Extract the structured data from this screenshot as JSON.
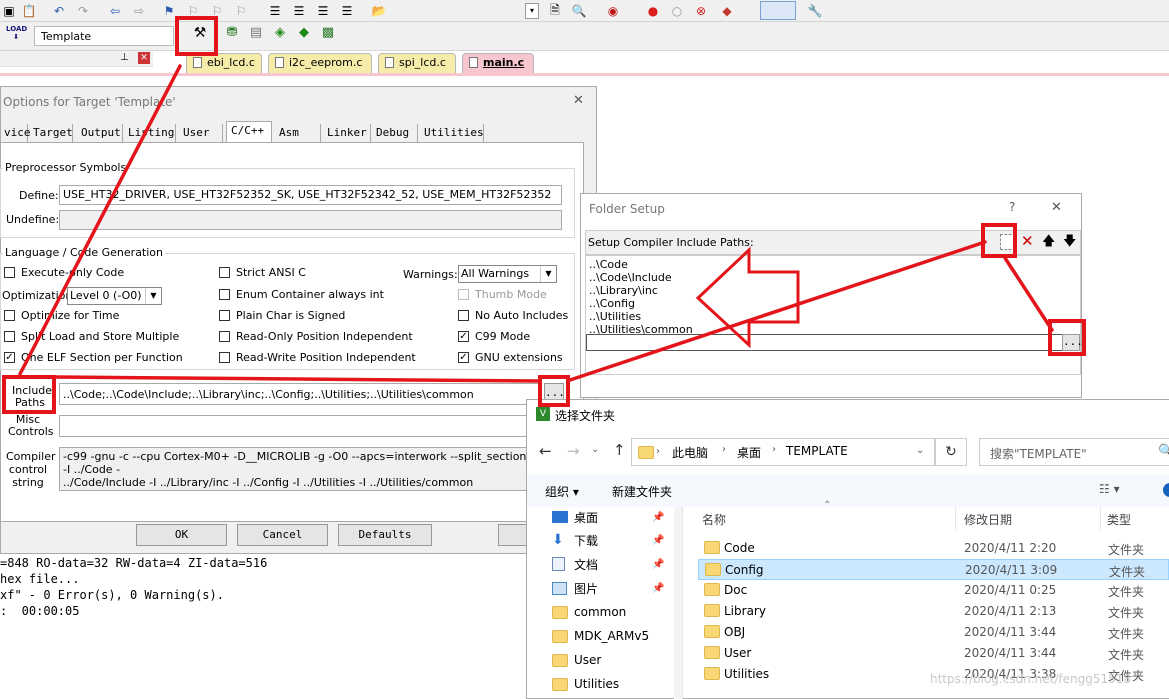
{
  "toolbar": {
    "target_name": "Template"
  },
  "file_tabs": [
    "ebi_lcd.c",
    "i2c_eeprom.c",
    "spi_lcd.c",
    "main.c"
  ],
  "options_dialog": {
    "title": "Options for Target 'Template'",
    "close": "✕",
    "tabs": [
      "vice",
      "Target",
      "Output",
      "Listing",
      "User",
      "C/C++",
      "Asm",
      "Linker",
      "Debug",
      "Utilities"
    ],
    "active_tab": "C/C++",
    "preprocessor": {
      "group": "Preprocessor Symbols",
      "define_label": "Define:",
      "define_value": "USE_HT32_DRIVER, USE_HT32F52352_SK, USE_HT32F52342_52, USE_MEM_HT32F52352",
      "undefine_label": "Undefine:",
      "undefine_value": ""
    },
    "language": {
      "group": "Language / Code Generation",
      "col1": [
        {
          "label": "Execute-only Code",
          "checked": false
        },
        {
          "label": "Optimize for Time",
          "checked": false
        },
        {
          "label": "Split Load and Store Multiple",
          "checked": false
        },
        {
          "label": "One ELF Section per Function",
          "checked": true
        }
      ],
      "optimization_label": "Optimization:",
      "optimization_value": "Level 0 (-O0)",
      "col2": [
        {
          "label": "Strict ANSI C",
          "checked": false
        },
        {
          "label": "Enum Container always int",
          "checked": false
        },
        {
          "label": "Plain Char is Signed",
          "checked": false
        },
        {
          "label": "Read-Only Position Independent",
          "checked": false
        },
        {
          "label": "Read-Write Position Independent",
          "checked": false
        }
      ],
      "warnings_label": "Warnings:",
      "warnings_value": "All Warnings",
      "col3": [
        {
          "label": "Thumb Mode",
          "checked": false,
          "disabled": true
        },
        {
          "label": "No Auto Includes",
          "checked": false
        },
        {
          "label": "C99 Mode",
          "checked": true
        },
        {
          "label": "GNU extensions",
          "checked": true
        }
      ]
    },
    "include_label_1": "Include",
    "include_label_2": "Paths",
    "include_value": "..\\Code;..\\Code\\Include;..\\Library\\inc;..\\Config;..\\Utilities;..\\Utilities\\common",
    "misc_label_1": "Misc",
    "misc_label_2": "Controls",
    "compiler_label_1": "Compiler",
    "compiler_label_2": "control",
    "compiler_label_3": "string",
    "compiler_line1": "-c99 -gnu -c --cpu Cortex-M0+ -D__MICROLIB -g -O0 --apcs=interwork --split_sections -I ../Code -",
    "compiler_line2": "../Code/Include -I ../Library/inc -I ../Config -I ../Utilities -I ../Utilities/common",
    "browse": "...",
    "buttons": {
      "ok": "OK",
      "cancel": "Cancel",
      "defaults": "Defaults"
    }
  },
  "build_output": [
    "=848 RO-data=32 RW-data=4 ZI-data=516",
    "hex file...",
    "xf\" - 0 Error(s), 0 Warning(s).",
    ":  00:00:05"
  ],
  "folder_setup": {
    "title": "Folder Setup",
    "help": "?",
    "close": "✕",
    "header": "Setup Compiler Include Paths:",
    "paths": [
      "..\\Code",
      "..\\Code\\Include",
      "..\\Library\\inc",
      "..\\Config",
      "..\\Utilities",
      "..\\Utilities\\common"
    ],
    "browse": "..."
  },
  "picker": {
    "title": "选择文件夹",
    "breadcrumb": [
      "此电脑",
      "桌面",
      "TEMPLATE"
    ],
    "search_placeholder": "搜索\"TEMPLATE\"",
    "organize": "组织 ▾",
    "new_folder": "新建文件夹",
    "nav": [
      {
        "label": "桌面",
        "kind": "desktop"
      },
      {
        "label": "下载",
        "kind": "download"
      },
      {
        "label": "文档",
        "kind": "doc"
      },
      {
        "label": "图片",
        "kind": "pic"
      },
      {
        "label": "common",
        "kind": "folder"
      },
      {
        "label": "MDK_ARMv5",
        "kind": "folder"
      },
      {
        "label": "User",
        "kind": "folder"
      },
      {
        "label": "Utilities",
        "kind": "folder"
      }
    ],
    "columns": {
      "name": "名称",
      "date": "修改日期",
      "type": "类型"
    },
    "rows": [
      {
        "name": "Code",
        "date": "2020/4/11 2:20",
        "type": "文件夹"
      },
      {
        "name": "Config",
        "date": "2020/4/11 3:09",
        "type": "文件夹",
        "selected": true
      },
      {
        "name": "Doc",
        "date": "2020/4/11 0:25",
        "type": "文件夹"
      },
      {
        "name": "Library",
        "date": "2020/4/11 2:13",
        "type": "文件夹"
      },
      {
        "name": "OBJ",
        "date": "2020/4/11 3:44",
        "type": "文件夹"
      },
      {
        "name": "User",
        "date": "2020/4/11 3:44",
        "type": "文件夹"
      },
      {
        "name": "Utilities",
        "date": "2020/4/11 3:38",
        "type": "文件夹"
      }
    ]
  },
  "watermark": "https://blog.csdn.net/fengg51518",
  "colors": {
    "annotation_red": "#e3151a",
    "selection": "#cce8ff",
    "tab_main": "#f7c6cf",
    "tab_yellow": "#f5ecaa"
  }
}
